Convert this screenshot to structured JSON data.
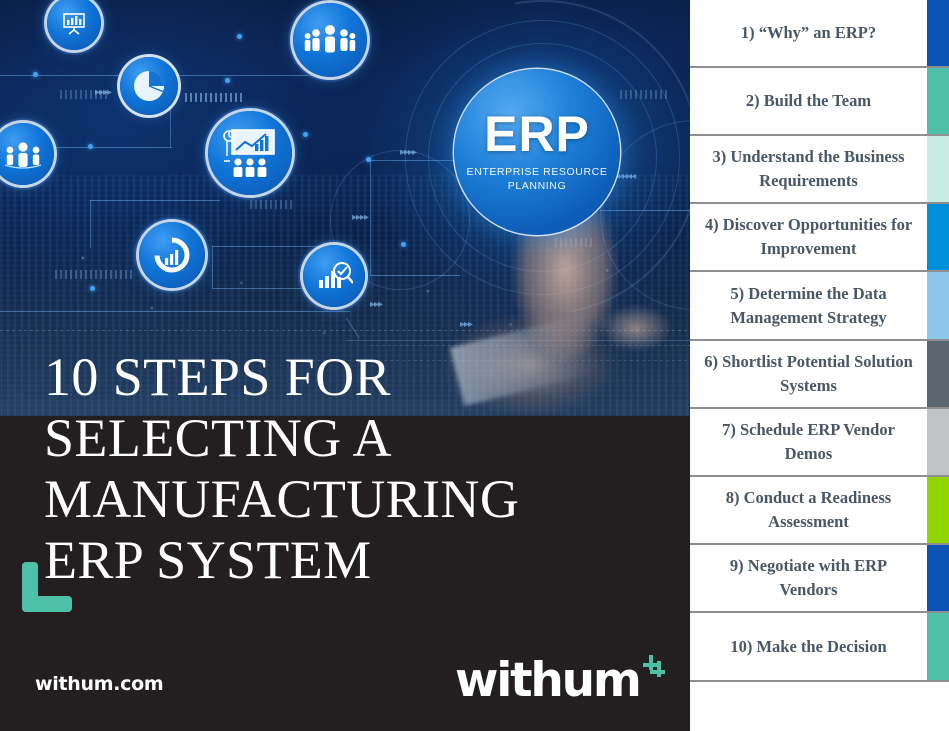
{
  "hero": {
    "badge_title": "ERP",
    "badge_subtitle": "ENTERPRISE RESOURCE\nPLANNING",
    "icons": [
      {
        "name": "bar-chart-icon"
      },
      {
        "name": "pie-chart-icon"
      },
      {
        "name": "people-group-icon"
      },
      {
        "name": "people-group-icon-2"
      },
      {
        "name": "presentation-chart-icon"
      },
      {
        "name": "donut-chart-icon"
      },
      {
        "name": "chart-search-icon"
      }
    ]
  },
  "title": {
    "line1": "10 STEPS FOR",
    "line2": "SELECTING A",
    "line3": "MANUFACTURING",
    "line4": "ERP SYSTEM"
  },
  "footer": {
    "website": "withum.com",
    "brand": "withum"
  },
  "sidebar": {
    "steps": [
      {
        "label": "1) “Why” an ERP?",
        "color": "#0B52B5"
      },
      {
        "label": "2) Build the Team",
        "color": "#4FC0A8"
      },
      {
        "label": "3) Understand the Business Requirements",
        "color": "#C8EBE2"
      },
      {
        "label": "4) Discover Opportunities for Improvement",
        "color": "#0090DC"
      },
      {
        "label": "5) Determine the Data Management Strategy",
        "color": "#8DC6E8"
      },
      {
        "label": "6) Shortlist Potential Solution Systems",
        "color": "#5A6670"
      },
      {
        "label": "7) Schedule ERP Vendor Demos",
        "color": "#C0C4C7"
      },
      {
        "label": "8) Conduct a Readiness Assessment",
        "color": "#92D400"
      },
      {
        "label": "9) Negotiate with ERP Vendors",
        "color": "#0B52B5"
      },
      {
        "label": "10) Make the Decision",
        "color": "#4FC0A8"
      }
    ]
  },
  "colors": {
    "panel_background": "#231F20",
    "accent_teal": "#4FC0A8",
    "text_slate": "#495867",
    "divider": "#8F8F8F"
  }
}
